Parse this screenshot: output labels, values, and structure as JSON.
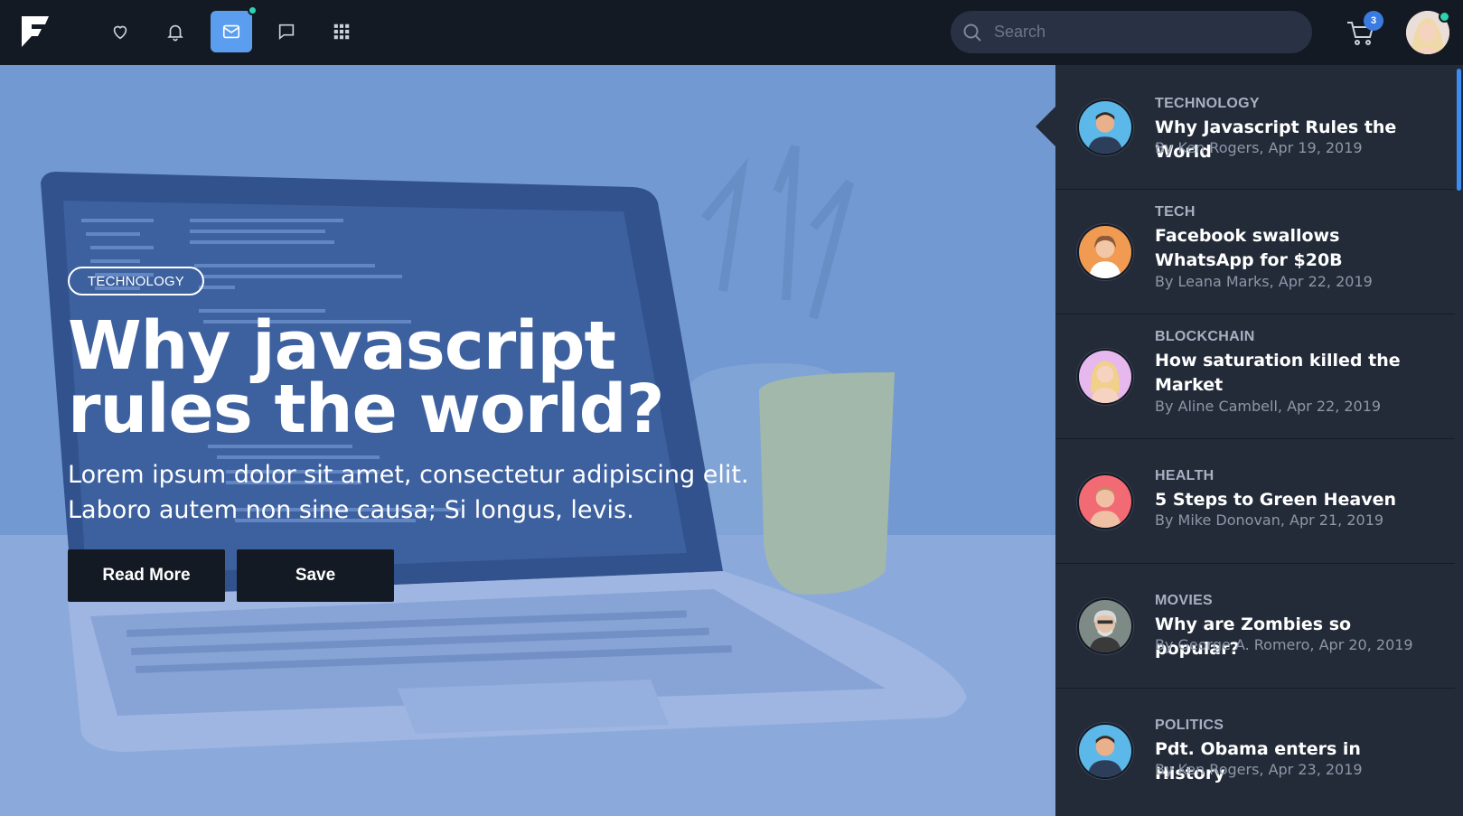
{
  "navbar": {
    "logo_icon": "brand-f-logo-icon",
    "icons": [
      "heart-icon",
      "bell-icon",
      "mail-icon",
      "chat-icon",
      "apps-grid-icon"
    ],
    "active_icon": "mail-icon",
    "search": {
      "placeholder": "Search",
      "value": ""
    },
    "cart_badge": "3",
    "accent_color": "#5b9ef0",
    "online_color": "#2dd4b0"
  },
  "hero": {
    "tag": "TECHNOLOGY",
    "title": "Why javascript rules the world?",
    "text": "Lorem ipsum dolor sit amet, consectetur adipiscing elit. Laboro autem non sine causa; Si longus, levis.",
    "read_more_label": "Read More",
    "save_label": "Save"
  },
  "sidebar": {
    "items": [
      {
        "category": "TECHNOLOGY",
        "title": "Why Javascript Rules the World",
        "meta": "By Ken Rogers, Apr 19, 2019",
        "avatar_color": "#5bb8e8"
      },
      {
        "category": "TECH",
        "title": "Facebook swallows WhatsApp for $20B",
        "meta": "By Leana Marks, Apr 22, 2019",
        "avatar_color": "#f09a52"
      },
      {
        "category": "BLOCKCHAIN",
        "title": "How saturation killed the Market",
        "meta": "By Aline Cambell, Apr 22, 2019",
        "avatar_color": "#e6b8ee"
      },
      {
        "category": "HEALTH",
        "title": "5 Steps to Green Heaven",
        "meta": "By Mike Donovan, Apr 21, 2019",
        "avatar_color": "#f26a73"
      },
      {
        "category": "MOVIES",
        "title": "Why are Zombies so popular?",
        "meta": "By George A. Romero, Apr 20, 2019",
        "avatar_color": "#7d8a86"
      },
      {
        "category": "POLITICS",
        "title": "Pdt. Obama enters in History",
        "meta": "By Ken Rogers, Apr 23, 2019",
        "avatar_color": "#5bb8e8"
      }
    ]
  }
}
